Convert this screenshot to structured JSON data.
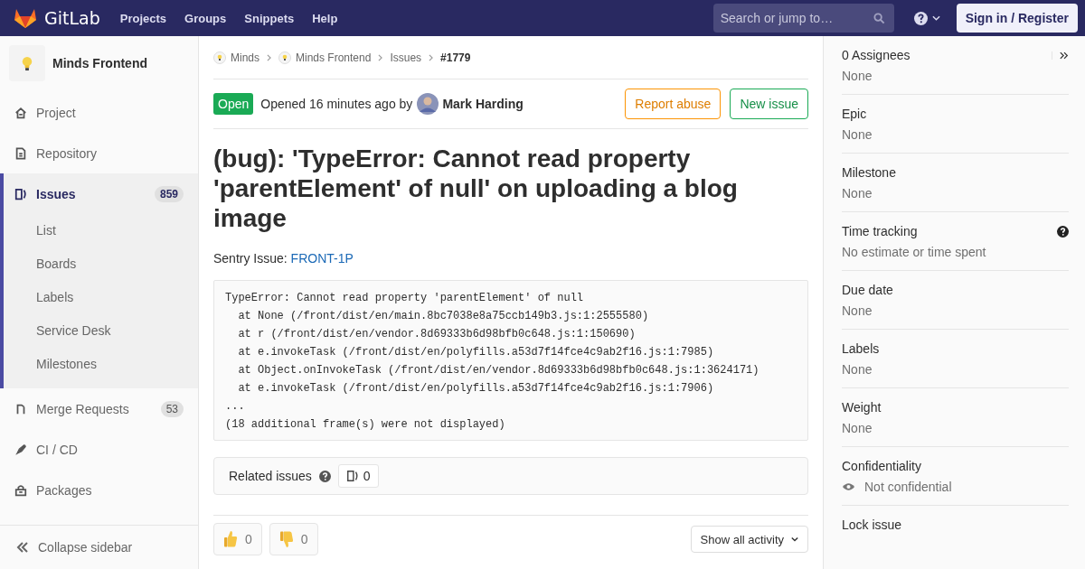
{
  "top_nav": {
    "brand": "GitLab",
    "links": [
      "Projects",
      "Groups",
      "Snippets",
      "Help"
    ],
    "search": {
      "placeholder": "Search or jump to…"
    },
    "sign_in": "Sign in / Register"
  },
  "project": {
    "name": "Minds Frontend"
  },
  "sidebar": {
    "items": [
      {
        "label": "Project",
        "selected": false
      },
      {
        "label": "Repository",
        "selected": false
      },
      {
        "label": "Issues",
        "count": "859",
        "selected": true,
        "children": [
          {
            "label": "List"
          },
          {
            "label": "Boards"
          },
          {
            "label": "Labels"
          },
          {
            "label": "Service Desk"
          },
          {
            "label": "Milestones"
          }
        ]
      },
      {
        "label": "Merge Requests",
        "count": "53",
        "selected": false
      },
      {
        "label": "CI / CD",
        "selected": false
      },
      {
        "label": "Packages",
        "selected": false
      }
    ],
    "collapse": "Collapse sidebar"
  },
  "breadcrumbs": [
    {
      "label": "Minds",
      "kind": "group"
    },
    {
      "label": "Minds Frontend",
      "kind": "group"
    },
    {
      "label": "Issues",
      "kind": "plain"
    },
    {
      "label": "#1779",
      "kind": "current"
    }
  ],
  "issue": {
    "status": "Open",
    "opened": "Opened 16 minutes ago by",
    "author": "Mark Harding",
    "actions": [
      {
        "label": "Report abuse",
        "kind": "warning"
      },
      {
        "label": "New issue",
        "kind": "success"
      }
    ],
    "title": "(bug): 'TypeError: Cannot read property 'parentElement' of null' on uploading a blog image",
    "description": {
      "label": "Sentry Issue:",
      "link": "FRONT-1P"
    },
    "code": [
      "TypeError: Cannot read property 'parentElement' of null",
      "  at None (/front/dist/en/main.8bc7038e8a75ccb149b3.js:1:2555580)",
      "  at r (/front/dist/en/vendor.8d69333b6d98bfb0c648.js:1:150690)",
      "  at e.invokeTask (/front/dist/en/polyfills.a53d7f14fce4c9ab2f16.js:1:7985)",
      "  at Object.onInvokeTask (/front/dist/en/vendor.8d69333b6d98bfb0c648.js:1:3624171)",
      "  at e.invokeTask (/front/dist/en/polyfills.a53d7f14fce4c9ab2f16.js:1:7906)",
      "...",
      "(18 additional frame(s) were not displayed)"
    ],
    "related": {
      "label": "Related issues",
      "count": "0"
    },
    "reactions": [
      {
        "kind": "thumbsup",
        "count": "0"
      },
      {
        "kind": "thumbsdown",
        "count": "0"
      }
    ],
    "activity_filter": "Show all activity"
  },
  "right_sidebar": {
    "sections": [
      {
        "kind": "assignees",
        "label": "0 Assignees",
        "value": "None"
      },
      {
        "kind": "plain",
        "label": "Epic",
        "value": "None"
      },
      {
        "kind": "plain",
        "label": "Milestone",
        "value": "None"
      },
      {
        "kind": "help",
        "label": "Time tracking",
        "value": "No estimate or time spent"
      },
      {
        "kind": "plain",
        "label": "Due date",
        "value": "None"
      },
      {
        "kind": "plain",
        "label": "Labels",
        "value": "None"
      },
      {
        "kind": "plain",
        "label": "Weight",
        "value": "None"
      },
      {
        "kind": "eye",
        "label": "Confidentiality",
        "value": "Not confidential"
      },
      {
        "kind": "plain",
        "label": "Lock issue"
      }
    ]
  }
}
